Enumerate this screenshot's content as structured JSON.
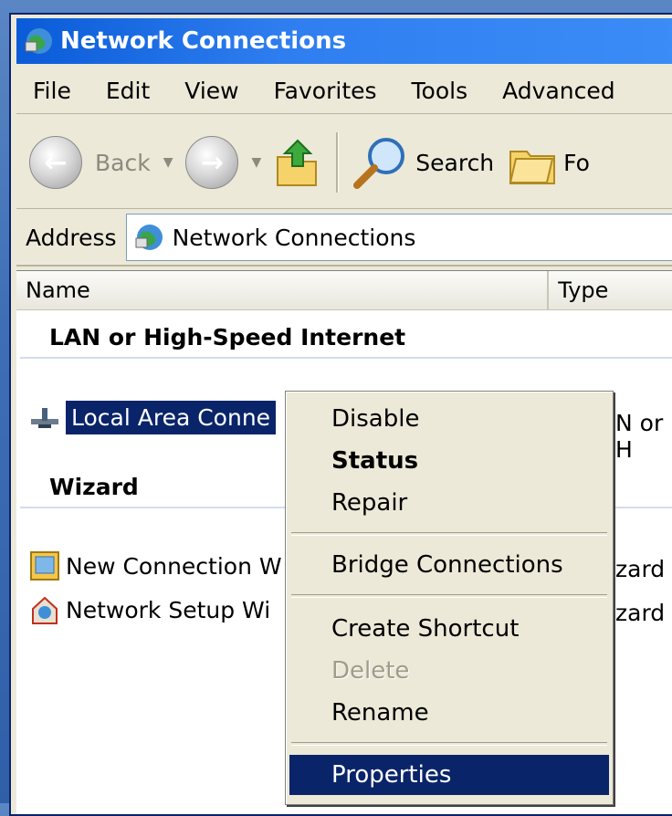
{
  "window": {
    "title": "Network Connections"
  },
  "menu": [
    "File",
    "Edit",
    "View",
    "Favorites",
    "Tools",
    "Advanced"
  ],
  "toolbar": {
    "back_label": "Back",
    "search_label": "Search",
    "folders_label": "Fo"
  },
  "address": {
    "label": "Address",
    "value": "Network Connections"
  },
  "columns": {
    "name": "Name",
    "type": "Type"
  },
  "groups": [
    {
      "title": "LAN or High-Speed Internet"
    },
    {
      "title": "Wizard"
    }
  ],
  "rows": {
    "lan": {
      "name": "Local Area Conne",
      "type": "N or H"
    },
    "wiz1": {
      "name": "New Connection W",
      "type": "zard"
    },
    "wiz2": {
      "name": "Network Setup Wi",
      "type": "zard"
    }
  },
  "context_menu": {
    "disable": "Disable",
    "status": "Status",
    "repair": "Repair",
    "bridge": "Bridge Connections",
    "shortcut": "Create Shortcut",
    "delete": "Delete",
    "rename": "Rename",
    "properties": "Properties"
  },
  "colors": {
    "titlebar": "#0a5bd8",
    "selection": "#0a246a",
    "chrome": "#ece9d8"
  }
}
